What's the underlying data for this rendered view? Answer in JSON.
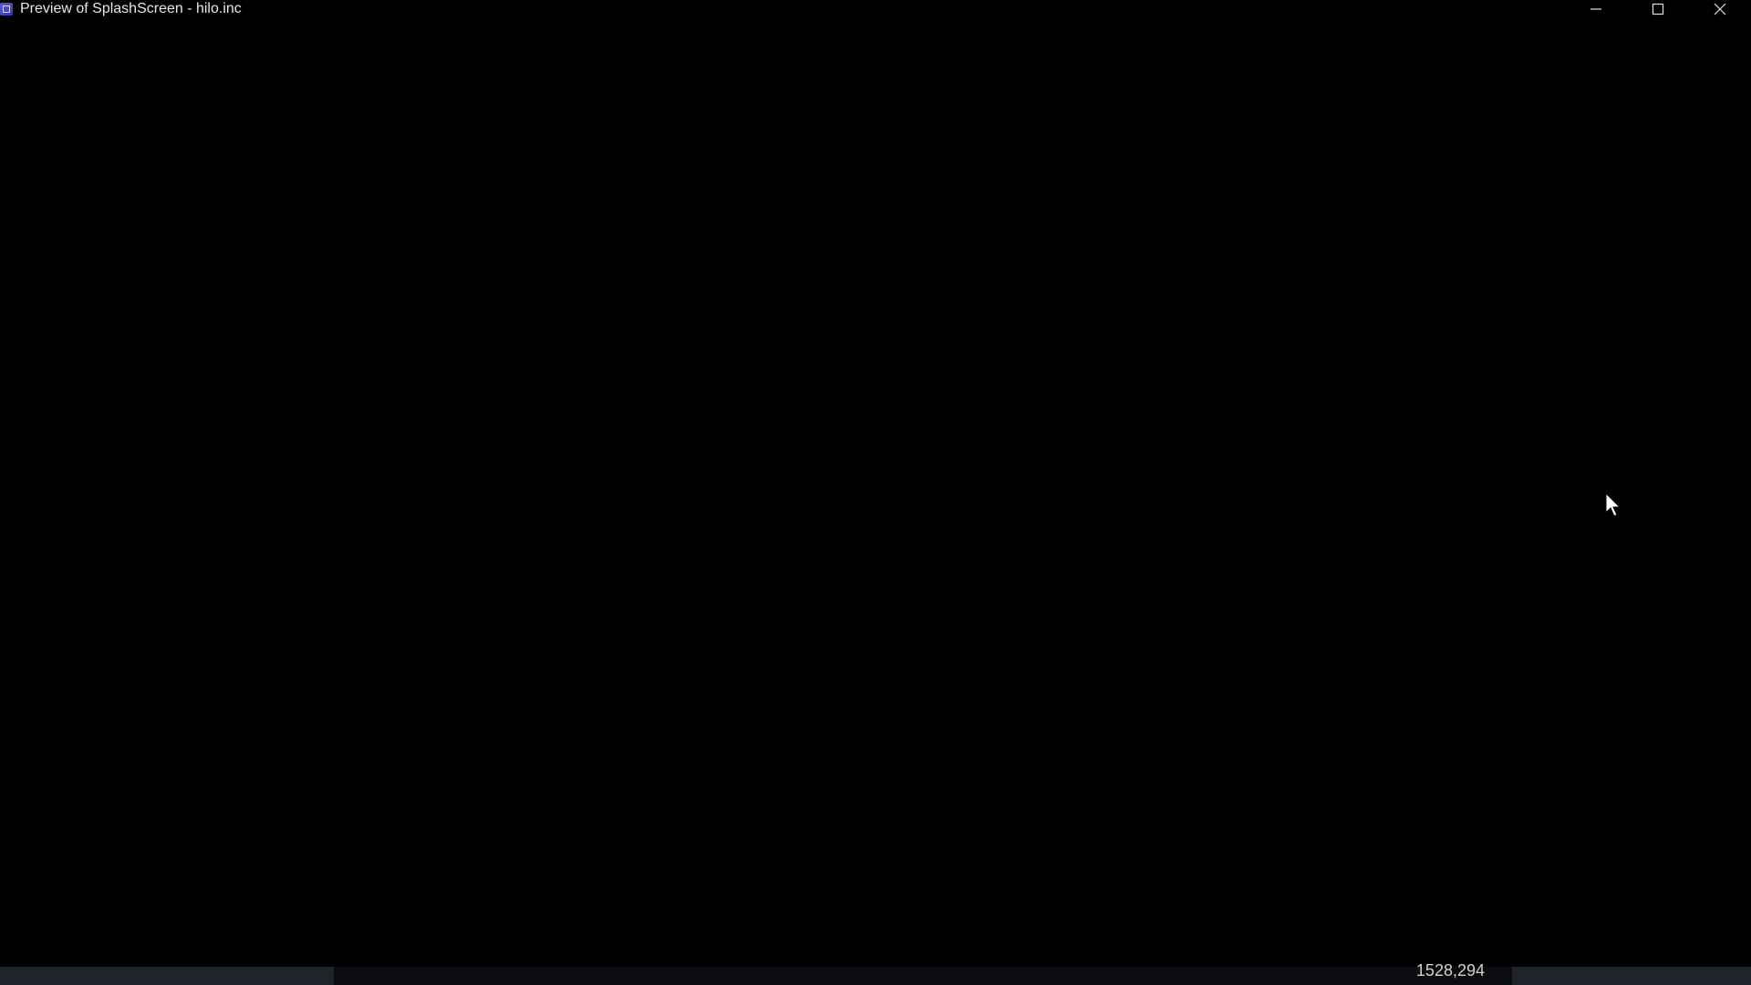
{
  "window": {
    "title": "Preview of SplashScreen - hilo.inc",
    "app_icon": "app-icon",
    "controls": {
      "minimize_icon": "minimize-icon",
      "maximize_icon": "maximize-icon",
      "close_icon": "close-icon"
    }
  },
  "canvas": {
    "background": "#000000",
    "cursor_icon": "mouse-pointer-icon"
  },
  "statusbar": {
    "coordinates": "1528,294"
  }
}
